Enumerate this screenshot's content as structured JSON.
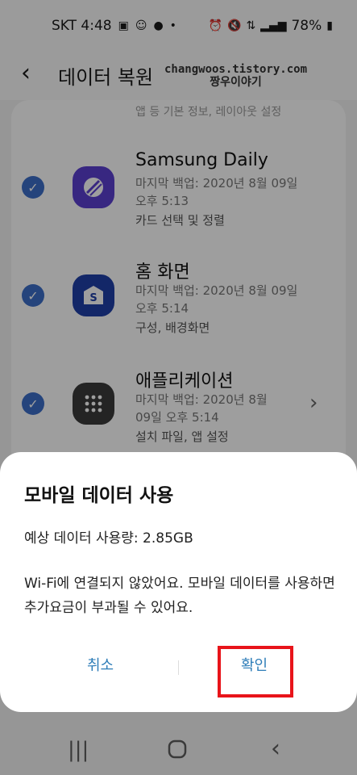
{
  "status": {
    "carrier_time": "SKT 4:48",
    "battery": "78%",
    "icons": [
      "gallery-icon",
      "emoji-icon",
      "talk-icon",
      "alarm-icon",
      "mute-icon",
      "lte-icon",
      "signal-icon",
      "battery-icon"
    ]
  },
  "app_bar": {
    "title": "데이터 복원",
    "watermark_line1": "changwoos.tistory.com",
    "watermark_line2": "짱우이야기"
  },
  "list": {
    "partial_top_text": "앱 등 기본 정보, 레이아웃 설정",
    "items": [
      {
        "title": "Samsung Daily",
        "backup_line1": "마지막 백업: 2020년 8월 09일",
        "backup_line2": "오후 5:13",
        "desc": "카드 선택 및 정렬",
        "icon": "samsung-daily-icon"
      },
      {
        "title": "홈 화면",
        "backup_line1": "마지막 백업: 2020년 8월 09일",
        "backup_line2": "오후 5:14",
        "desc": "구성, 배경화면",
        "icon": "home-screen-icon"
      },
      {
        "title": "애플리케이션",
        "backup_line1": "마지막 백업: 2020년 8월",
        "backup_line2": "09일 오후 5:14",
        "desc": "설치 파일, 앱 설정",
        "icon": "apps-grid-icon"
      }
    ]
  },
  "dialog": {
    "title": "모바일 데이터 사용",
    "usage": "예상 데이터 사용량: 2.85GB",
    "message": "Wi-Fi에 연결되지 않았어요. 모바일 데이터를 사용하면 추가요금이 부과될 수 있어요.",
    "cancel_label": "취소",
    "confirm_label": "확인"
  },
  "colors": {
    "accent": "#2e7db8",
    "check": "#3d6fc9",
    "highlight": "#e8141a",
    "samsung_daily": "#5b3fd1",
    "home_icon": "#1f3fa8",
    "apps_icon": "#3a3a3a"
  }
}
